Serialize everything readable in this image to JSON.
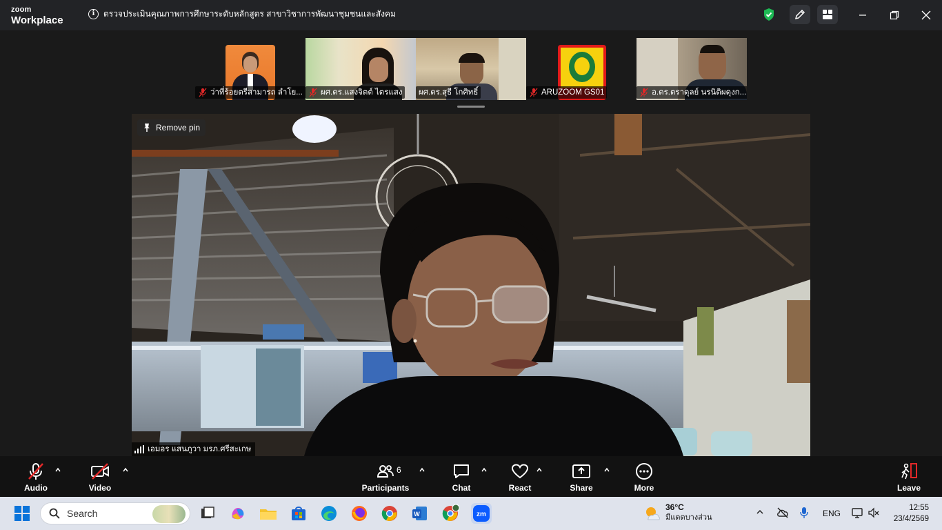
{
  "app": {
    "brand_small": "zoom",
    "brand_large": "Workplace"
  },
  "meeting": {
    "title": "ตรวจประเมินคุณภาพการศึกษาระดับหลักสูตร สาขาวิชาการพัฒนาชุมชนและสังคม"
  },
  "thumbnails": [
    {
      "name": "ว่าที่ร้อยตรีสามารถ ลำโย...",
      "muted": true
    },
    {
      "name": "ผศ.ดร.แสงจิตต์  ไตรแสง",
      "muted": true
    },
    {
      "name": "ผศ.ดร.สุธี  โกศิทธิ์",
      "muted": false
    },
    {
      "name": "ARUZOOM GS01",
      "muted": true
    },
    {
      "name": "อ.ดร.ตราดุลย์ นรนิติผดุงก...",
      "muted": true
    }
  ],
  "main_video": {
    "remove_pin_label": "Remove pin",
    "speaker_name": "เอมอร แสนภูวา มรภ.ศรีสะเกษ"
  },
  "controls": {
    "audio": "Audio",
    "video": "Video",
    "participants": "Participants",
    "participants_count": "6",
    "chat": "Chat",
    "react": "React",
    "share": "Share",
    "more": "More",
    "leave": "Leave"
  },
  "taskbar": {
    "search_placeholder": "Search",
    "temperature": "36°C",
    "weather_desc": "มีแดดบางส่วน",
    "language": "ENG",
    "time": "12:55",
    "date": "23/4/2569"
  },
  "colors": {
    "shield": "#1db954",
    "leave_red": "#e02828",
    "titlebar": "#222326",
    "controls_bg": "#121212"
  }
}
